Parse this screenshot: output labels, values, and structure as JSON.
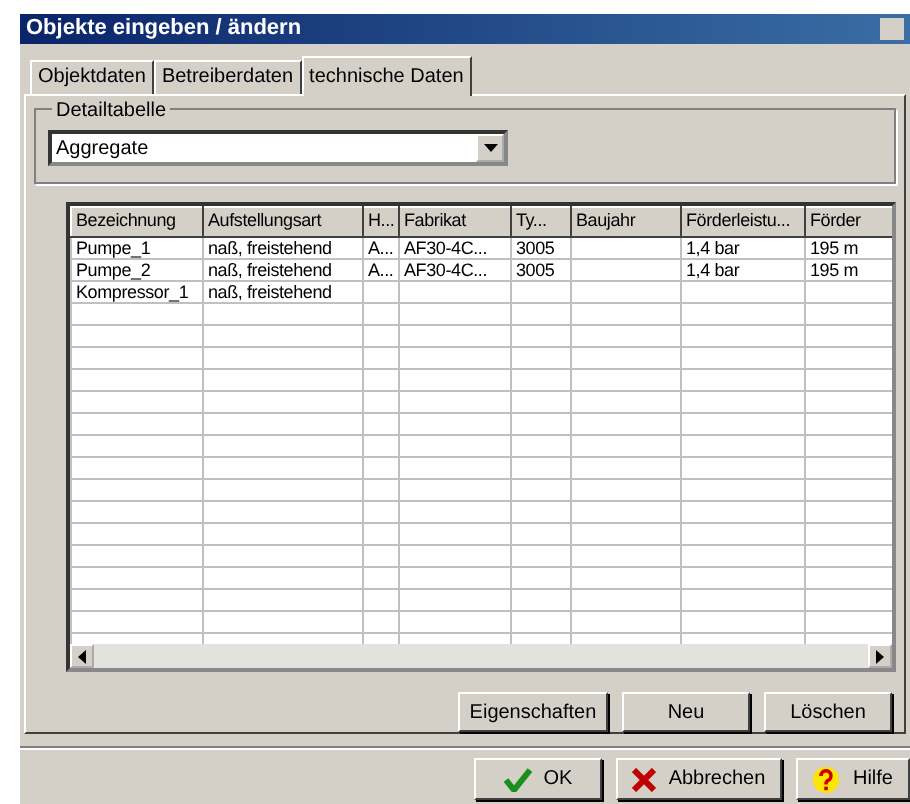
{
  "window": {
    "title": "Objekte eingeben / ändern"
  },
  "tabs": [
    {
      "label": "Objektdaten",
      "selected": false
    },
    {
      "label": "Betreiberdaten",
      "selected": false
    },
    {
      "label": "technische Daten",
      "selected": true
    }
  ],
  "detail_group": {
    "label": "Detailtabelle",
    "select_value": "Aggregate"
  },
  "table": {
    "columns": [
      "Bezeichnung",
      "Aufstellungsart",
      "H...",
      "Fabrikat",
      "Ty...",
      "Baujahr",
      "Förderleistu...",
      "Förder"
    ],
    "rows": [
      [
        "Pumpe_1",
        "naß, freistehend",
        "A...",
        "AF30-4C...",
        "3005",
        "",
        "1,4 bar",
        "195 m"
      ],
      [
        "Pumpe_2",
        "naß, freistehend",
        "A...",
        "AF30-4C...",
        "3005",
        "",
        "1,4 bar",
        "195 m"
      ],
      [
        "Kompressor_1",
        "naß, freistehend",
        "",
        "",
        "",
        "",
        "",
        ""
      ]
    ]
  },
  "table_buttons": [
    "Eigenschaften",
    "Neu",
    "Löschen"
  ],
  "dialog_buttons": [
    {
      "kind": "ok",
      "label": "OK"
    },
    {
      "kind": "cancel",
      "label": "Abbrechen"
    },
    {
      "kind": "help",
      "label": "Hilfe"
    }
  ]
}
